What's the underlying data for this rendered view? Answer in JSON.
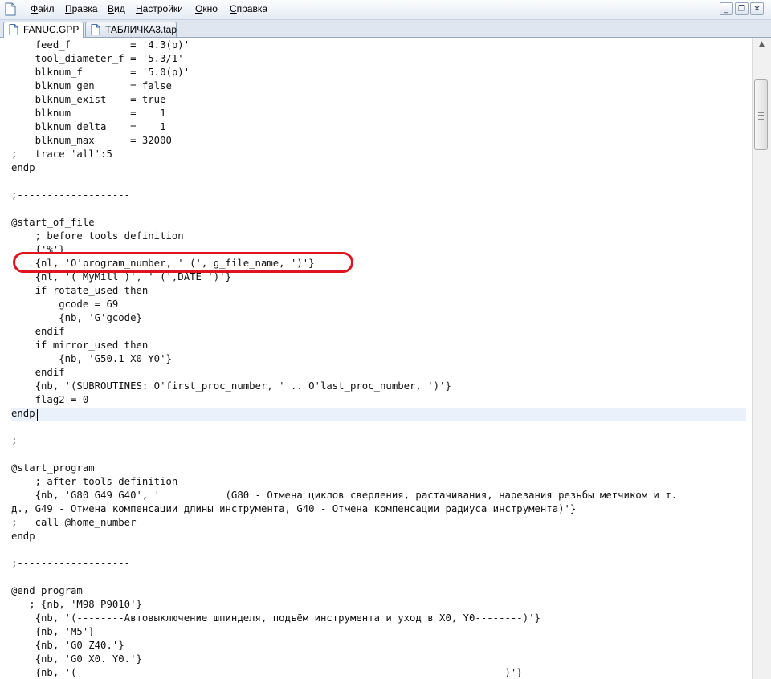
{
  "menubar": {
    "items": [
      "Файл",
      "Правка",
      "Вид",
      "Настройки",
      "Окно",
      "Справка"
    ],
    "window_buttons": {
      "minimize": "_",
      "restore": "❐",
      "close": "✕"
    }
  },
  "tabs": [
    {
      "label": "FANUC.GPP",
      "active": true
    },
    {
      "label": "ТАБЛИЧКА3.tap",
      "active": false
    }
  ],
  "editor": {
    "lines": [
      "    feed_f          = '4.3(p)'",
      "    tool_diameter_f = '5.3/1'",
      "    blknum_f        = '5.0(p)'",
      "    blknum_gen      = false",
      "    blknum_exist    = true",
      "    blknum          =    1",
      "    blknum_delta    =    1",
      "    blknum_max      = 32000",
      ";   trace 'all':5",
      "endp",
      "",
      ";-------------------",
      "",
      "@start_of_file",
      "    ; before tools definition",
      "    {'%'}",
      "    {nl, 'O'program_number, ' (', g_file_name, ')'}",
      "    {nl, '( MyMill )', ' (',DATE ')'}",
      "    if rotate_used then",
      "        gcode = 69",
      "        {nb, 'G'gcode}",
      "    endif",
      "    if mirror_used then",
      "        {nb, 'G50.1 X0 Y0'}",
      "    endif",
      "    {nb, '(SUBROUTINES: O'first_proc_number, ' .. O'last_proc_number, ')'}",
      "    flag2 = 0",
      "endp",
      "",
      ";-------------------",
      "",
      "@start_program",
      "    ; after tools definition",
      "    {nb, 'G80 G49 G40', '           (G80 - Отмена циклов сверления, растачивания, нарезания резьбы метчиком и т.",
      "д., G49 - Отмена компенсации длины инструмента, G40 - Отмена компенсации радиуса инструмента)'}",
      ";   call @home_number",
      "endp",
      "",
      ";-------------------",
      "",
      "@end_program",
      "   ; {nb, 'M98 P9010'}",
      "    {nb, '(--------Автовыключение шпинделя, подъём инструмента и уход в X0, Y0--------)'}",
      "    {nb, 'M5'}",
      "    {nb, 'G0 Z40.'}",
      "    {nb, 'G0 X0. Y0.'}",
      "    {nb, '(------------------------------------------------------------------------)'}"
    ],
    "highlighted_line_index": 16,
    "caret_line_index": 27,
    "highlight_color": "#e0141e"
  }
}
